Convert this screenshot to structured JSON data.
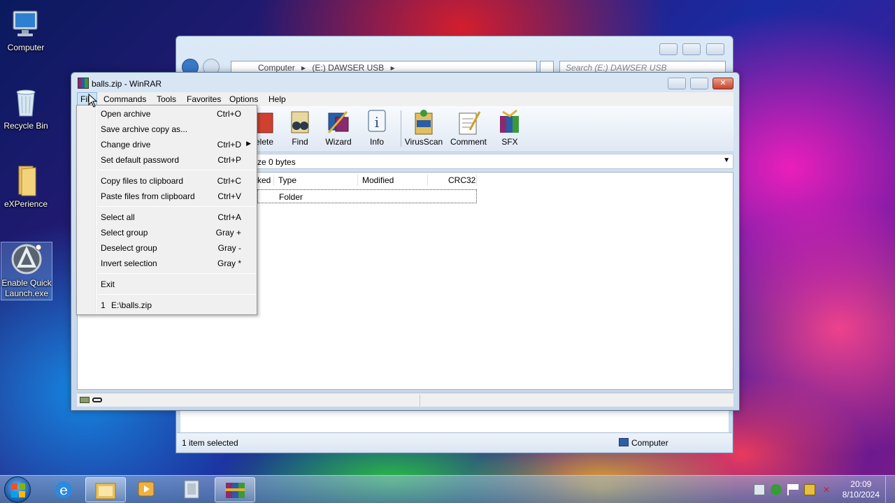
{
  "desktop": {
    "icons": [
      {
        "label": "Computer"
      },
      {
        "label": "Recycle Bin"
      },
      {
        "label": "eXPerience"
      },
      {
        "label": "Enable Quick Launch.exe"
      }
    ]
  },
  "explorer": {
    "breadcrumb": [
      "Computer",
      "(E:) DAWSER USB"
    ],
    "search_placeholder": "Search (E:) DAWSER USB",
    "status_text": "1 item selected",
    "status_location": "Computer"
  },
  "winrar": {
    "title": "balls.zip - WinRAR",
    "menu": [
      "File",
      "Commands",
      "Tools",
      "Favorites",
      "Options",
      "Help"
    ],
    "toolbar": [
      {
        "label": "elete",
        "icon": "delete-icon"
      },
      {
        "label": "Find",
        "icon": "find-icon"
      },
      {
        "label": "Wizard",
        "icon": "wizard-icon"
      },
      {
        "label": "Info",
        "icon": "info-icon"
      },
      {
        "label": "VirusScan",
        "icon": "virusscan-icon"
      },
      {
        "label": "Comment",
        "icon": "comment-icon"
      },
      {
        "label": "SFX",
        "icon": "sfx-icon"
      }
    ],
    "path_text": "ze 0 bytes",
    "columns": [
      "ked",
      "Type",
      "Modified",
      "CRC32"
    ],
    "rows": [
      {
        "type": "Folder"
      }
    ]
  },
  "file_menu": {
    "items": [
      {
        "label": "Open archive",
        "shortcut": "Ctrl+O"
      },
      {
        "label": "Save archive copy as...",
        "shortcut": ""
      },
      {
        "label": "Change drive",
        "shortcut": "Ctrl+D"
      },
      {
        "label": "Set default password",
        "shortcut": "Ctrl+P"
      },
      {
        "label": "Copy files to clipboard",
        "shortcut": "Ctrl+C"
      },
      {
        "label": "Paste files from clipboard",
        "shortcut": "Ctrl+V"
      },
      {
        "label": "Select all",
        "shortcut": "Ctrl+A"
      },
      {
        "label": "Select group",
        "shortcut": "Gray +"
      },
      {
        "label": "Deselect group",
        "shortcut": "Gray -"
      },
      {
        "label": "Invert selection",
        "shortcut": "Gray *"
      },
      {
        "label": "Exit",
        "shortcut": ""
      }
    ],
    "recent": {
      "index": "1",
      "path": "E:\\balls.zip"
    }
  },
  "taskbar": {
    "time": "20:09",
    "date": "8/10/2024"
  },
  "colors": {
    "menu_bg": "#f0f0f0",
    "window_frame": "#c6d7ea",
    "taskbar": "#5a82aa"
  }
}
